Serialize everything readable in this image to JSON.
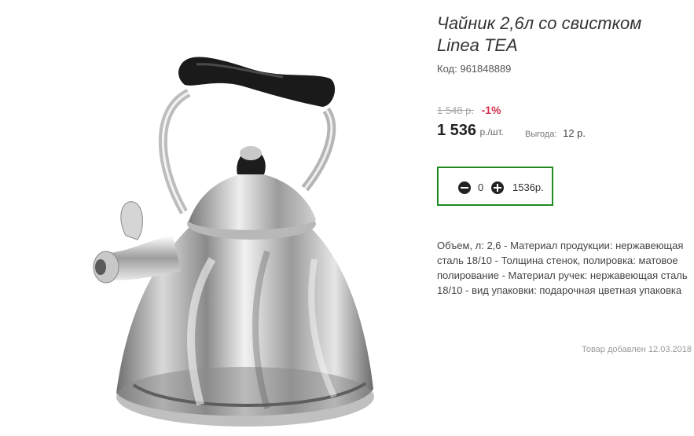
{
  "product": {
    "title": "Чайник 2,6л со свистком Linea TEA",
    "code_label": "Код:",
    "code_value": "961848889",
    "old_price": "1 548 р.",
    "discount": "-1%",
    "price": "1 536",
    "price_unit": "р./шт.",
    "benefit_label": "Выгода:",
    "benefit_value": "12 р.",
    "description": "Объем, л: 2,6 - Материал продукции: нержавеющая сталь 18/10 - Толщина стенок, полировка: матовое полирование - Материал ручек: нержавеющая сталь 18/10 - вид упаковки: подарочная цветная упаковка",
    "added_date": "Товар добавлен 12.03.2018"
  },
  "cart": {
    "quantity": "0",
    "total": "1536р.",
    "minus_icon": "minus-circle-icon",
    "plus_icon": "plus-circle-icon"
  },
  "colors": {
    "discount": "#d9304f",
    "qty_border": "#1f8a1f"
  }
}
